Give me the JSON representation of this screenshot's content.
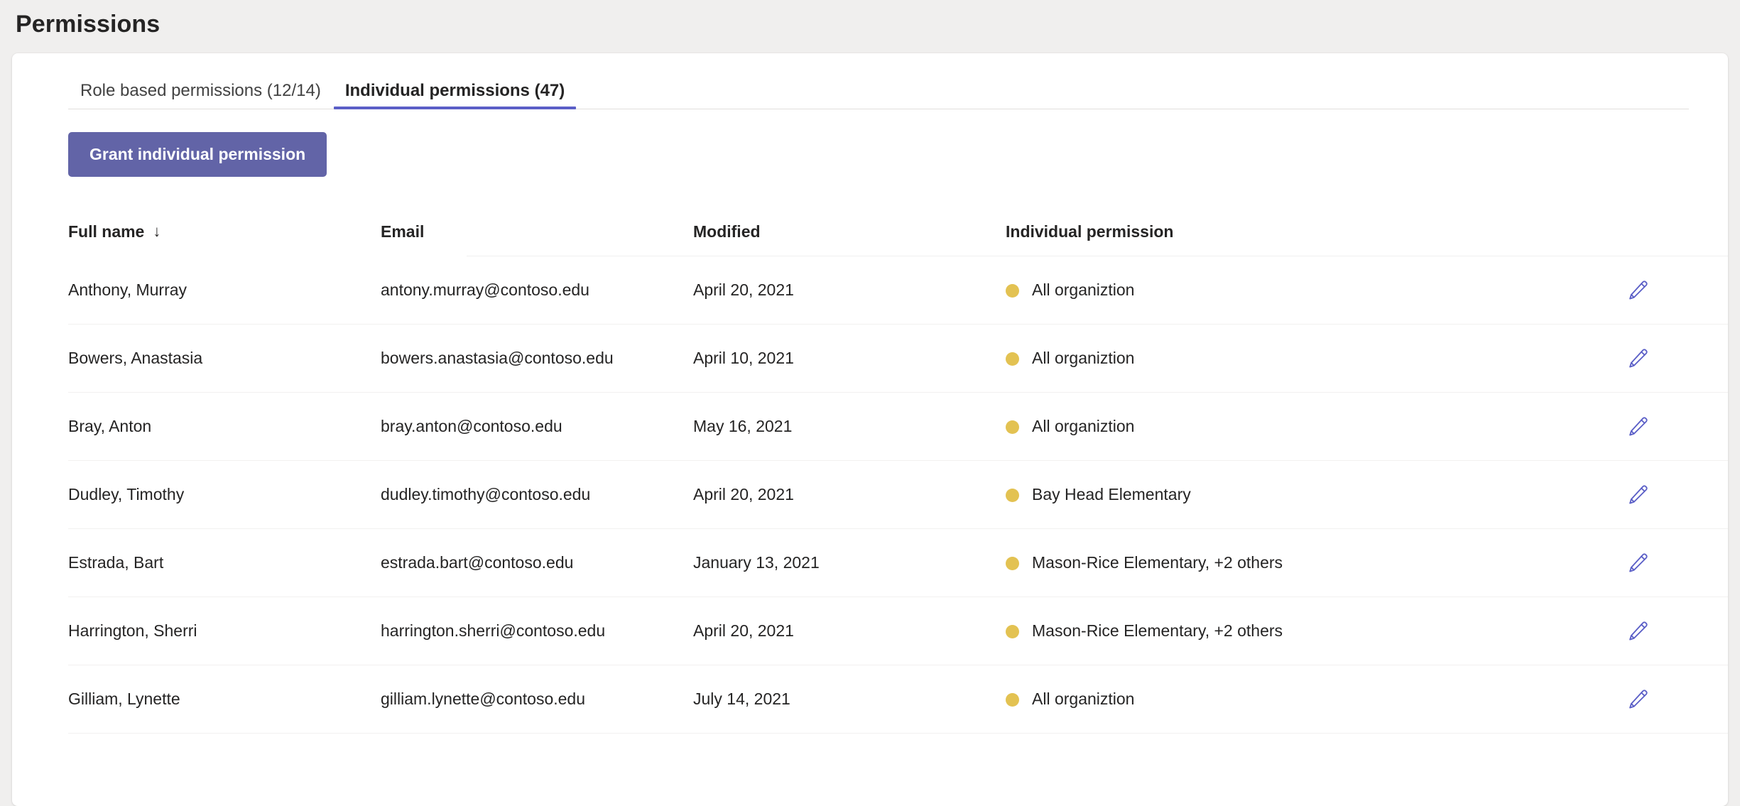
{
  "page": {
    "title": "Permissions"
  },
  "tabs": [
    {
      "label": "Role based permissions (12/14)",
      "active": false
    },
    {
      "label": "Individual permissions (47)",
      "active": true
    }
  ],
  "toolbar": {
    "grant_label": "Grant individual permission"
  },
  "table": {
    "columns": [
      {
        "label": "Full name",
        "sort_indicator": "↓"
      },
      {
        "label": "Email"
      },
      {
        "label": "Modified"
      },
      {
        "label": "Individual permission"
      }
    ],
    "rows": [
      {
        "name": "Anthony, Murray",
        "email": "antony.murray@contoso.edu",
        "modified": "April 20, 2021",
        "permission": "All organiztion",
        "status_color": "#e3c252",
        "action": "edit"
      },
      {
        "name": "Bowers, Anastasia",
        "email": "bowers.anastasia@contoso.edu",
        "modified": "April 10, 2021",
        "permission": "All organiztion",
        "status_color": "#e3c252",
        "action": "edit"
      },
      {
        "name": "Bray, Anton",
        "email": "bray.anton@contoso.edu",
        "modified": "May 16, 2021",
        "permission": "All organiztion",
        "status_color": "#e3c252",
        "action": "edit"
      },
      {
        "name": "Dudley, Timothy",
        "email": "dudley.timothy@contoso.edu",
        "modified": "April 20, 2021",
        "permission": "Bay Head Elementary",
        "status_color": "#e3c252",
        "action": "edit"
      },
      {
        "name": "Estrada, Bart",
        "email": "estrada.bart@contoso.edu",
        "modified": "January 13, 2021",
        "permission": "Mason-Rice Elementary, +2 others",
        "status_color": "#e3c252",
        "action": "edit"
      },
      {
        "name": "Harrington, Sherri",
        "email": "harrington.sherri@contoso.edu",
        "modified": "April 20, 2021",
        "permission": "Mason-Rice Elementary, +2 others",
        "status_color": "#e3c252",
        "action": "edit"
      },
      {
        "name": "Gilliam, Lynette",
        "email": "gilliam.lynette@contoso.edu",
        "modified": "July 14, 2021",
        "permission": "All organiztion",
        "status_color": "#e3c252",
        "action": "edit"
      }
    ]
  },
  "colors": {
    "accent": "#6264a7",
    "tab_underline": "#5b5fc7",
    "status_dot": "#e3c252",
    "page_background": "#f0efee",
    "card_background": "#ffffff",
    "text": "#252424"
  },
  "icons": {
    "edit": "pencil-icon",
    "sort": "arrow-down-icon"
  }
}
